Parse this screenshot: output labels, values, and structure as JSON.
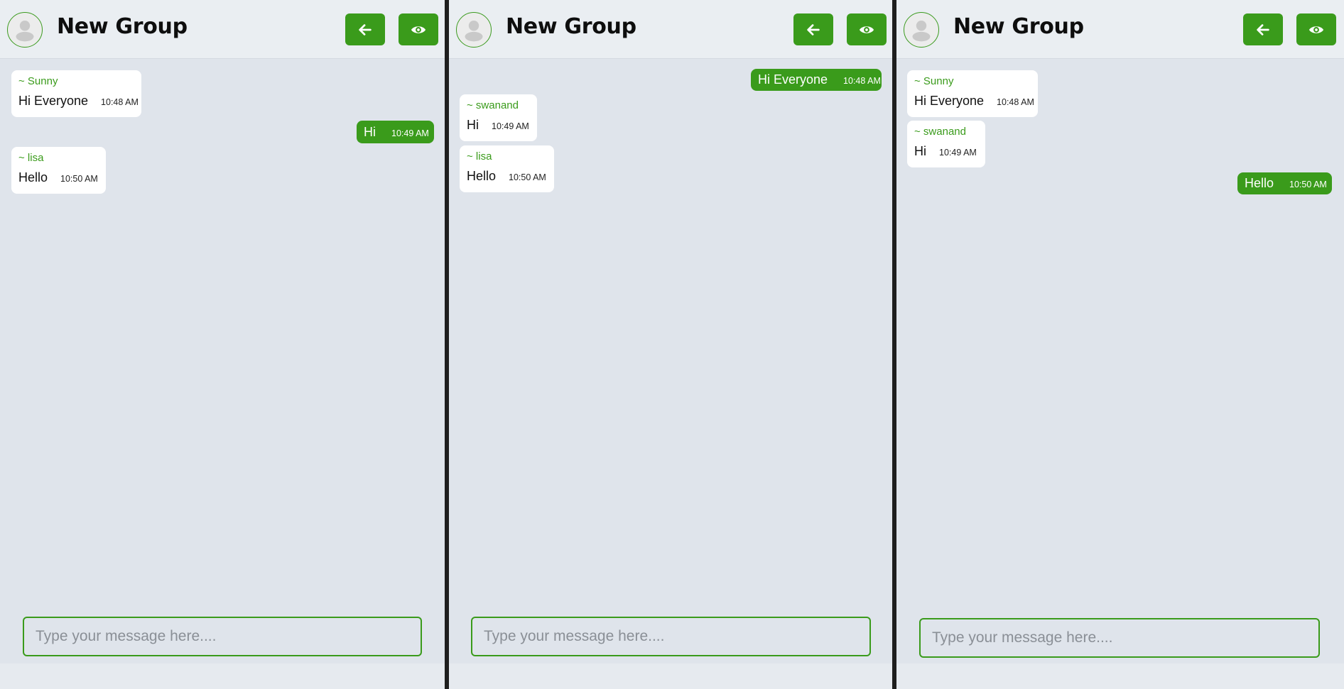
{
  "windows": [
    {
      "header": {
        "title": "New Group",
        "back_icon": "arrow-left-icon",
        "view_icon": "eye-icon"
      },
      "messages": [
        {
          "direction": "in",
          "sender": "~ Sunny",
          "text": "Hi Everyone",
          "time": "10:48 AM"
        },
        {
          "direction": "out",
          "text": "Hi",
          "time": "10:49 AM"
        },
        {
          "direction": "in",
          "sender": "~ lisa",
          "text": "Hello",
          "time": "10:50 AM"
        }
      ],
      "composer": {
        "placeholder": "Type your message here...."
      }
    },
    {
      "header": {
        "title": "New Group",
        "back_icon": "arrow-left-icon",
        "view_icon": "eye-icon"
      },
      "messages": [
        {
          "direction": "out",
          "text": "Hi Everyone",
          "time": "10:48 AM"
        },
        {
          "direction": "in",
          "sender": "~ swanand",
          "text": "Hi",
          "time": "10:49 AM"
        },
        {
          "direction": "in",
          "sender": "~ lisa",
          "text": "Hello",
          "time": "10:50 AM"
        }
      ],
      "composer": {
        "placeholder": "Type your message here...."
      }
    },
    {
      "header": {
        "title": "New Group",
        "back_icon": "arrow-left-icon",
        "view_icon": "eye-icon"
      },
      "messages": [
        {
          "direction": "in",
          "sender": "~ Sunny",
          "text": "Hi Everyone",
          "time": "10:48 AM"
        },
        {
          "direction": "in",
          "sender": "~ swanand",
          "text": "Hi",
          "time": "10:49 AM"
        },
        {
          "direction": "out",
          "text": "Hello",
          "time": "10:50 AM"
        }
      ],
      "composer": {
        "placeholder": "Type your message here...."
      }
    }
  ],
  "colors": {
    "accent": "#3a9b1b",
    "chat_bg": "#dfe4eb",
    "header_bg": "#eaeef2",
    "bubble_in": "#ffffff"
  }
}
